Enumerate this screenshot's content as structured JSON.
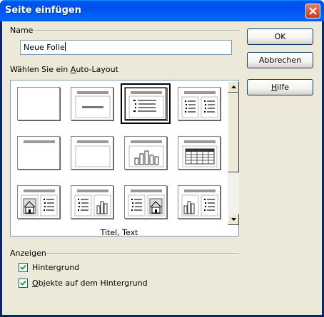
{
  "window": {
    "title": "Seite einfügen"
  },
  "name_group": {
    "label": "Name",
    "value": "Neue Folie"
  },
  "layout_group": {
    "label_prefix": "Wählen Sie ein ",
    "label_access": "A",
    "label_suffix": "uto-Layout",
    "caption": "Titel, Text",
    "thumbnails": [
      {
        "id": "blank"
      },
      {
        "id": "title-only-center"
      },
      {
        "id": "title-text",
        "selected": true
      },
      {
        "id": "title-two-text"
      },
      {
        "id": "title-only"
      },
      {
        "id": "title-object"
      },
      {
        "id": "title-chart"
      },
      {
        "id": "title-table"
      },
      {
        "id": "title-clipart-text"
      },
      {
        "id": "title-text-chart"
      },
      {
        "id": "title-text-clipart"
      },
      {
        "id": "title-chart-text"
      }
    ]
  },
  "buttons": {
    "ok": "OK",
    "cancel": "Abbrechen",
    "help_access": "H",
    "help_rest": "ilfe"
  },
  "display_group": {
    "label": "Anzeigen",
    "background": {
      "prefix": "Hinter",
      "access": "g",
      "suffix": "rund",
      "checked": true
    },
    "objects": {
      "prefix": "",
      "access": "O",
      "suffix": "bjekte auf dem Hintergrund",
      "checked": true
    }
  },
  "icons": {
    "close": "close-icon",
    "scroll_up": "arrow-up-icon",
    "scroll_down": "arrow-down-icon",
    "check": "checkmark-icon"
  },
  "colors": {
    "titlebar": "#0054e3",
    "face": "#ece9d8",
    "close": "#c83c19"
  }
}
